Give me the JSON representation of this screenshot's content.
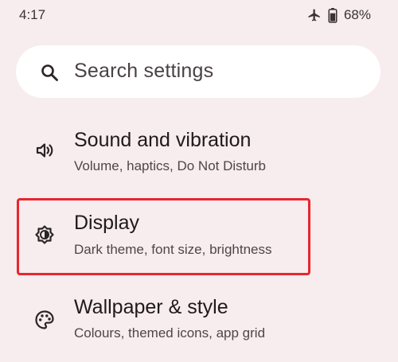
{
  "status_bar": {
    "time": "4:17",
    "battery": "68%",
    "icons": [
      "airplane-mode-icon",
      "battery-icon"
    ]
  },
  "search": {
    "placeholder": "Search settings",
    "icon": "search-icon"
  },
  "items": [
    {
      "title": "Sound and vibration",
      "subtitle": "Volume, haptics, Do Not Disturb",
      "icon": "speaker-icon"
    },
    {
      "title": "Display",
      "subtitle": "Dark theme, font size, brightness",
      "icon": "brightness-icon"
    },
    {
      "title": "Wallpaper & style",
      "subtitle": "Colours, themed icons, app grid",
      "icon": "palette-icon"
    }
  ],
  "colors": {
    "background": "#f7ecee",
    "search_background": "#ffffff",
    "highlight": "#e8262d"
  }
}
